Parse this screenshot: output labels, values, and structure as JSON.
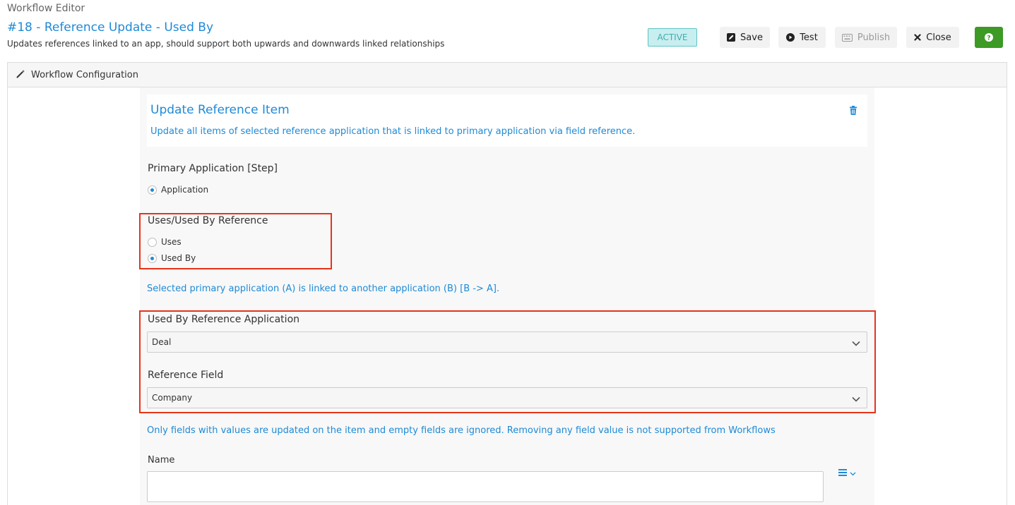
{
  "header": {
    "app_title": "Workflow Editor",
    "workflow_title": "#18 - Reference Update - Used By",
    "workflow_description": "Updates references linked to an app, should support both upwards and downwards linked relationships",
    "status_badge": "ACTIVE"
  },
  "toolbar": {
    "save_label": "Save",
    "test_label": "Test",
    "publish_label": "Publish",
    "close_label": "Close"
  },
  "panel": {
    "title": "Workflow Configuration"
  },
  "step": {
    "title": "Update Reference Item",
    "description": "Update all items of selected reference application that is linked to primary application via field reference."
  },
  "primary_application": {
    "label": "Primary Application [Step]",
    "options": [
      {
        "label": "Application",
        "checked": true
      }
    ]
  },
  "reference_direction": {
    "label": "Uses/Used By Reference",
    "options": [
      {
        "label": "Uses",
        "checked": false
      },
      {
        "label": "Used By",
        "checked": true
      }
    ],
    "info": "Selected primary application (A) is linked to another application (B) [B -> A]."
  },
  "reference_application": {
    "label": "Used By Reference Application",
    "selected": "Deal"
  },
  "reference_field": {
    "label": "Reference Field",
    "selected": "Company"
  },
  "fields_note": "Only fields with values are updated on the item and empty fields are ignored. Removing any field value is not supported from Workflows",
  "name_field": {
    "label": "Name",
    "value": ""
  },
  "colors": {
    "accent_blue": "#1e8ad6",
    "help_green": "#3c9a25",
    "active_badge_bg": "#c9eef0",
    "highlight_red": "#e8331a"
  },
  "icons": {
    "save": "edit-icon",
    "test": "play-icon",
    "publish": "keyboard-icon",
    "close": "close-icon",
    "help": "question-icon",
    "panel": "magic-wand-icon",
    "delete": "trash-icon",
    "field_menu": "list-menu-icon"
  }
}
